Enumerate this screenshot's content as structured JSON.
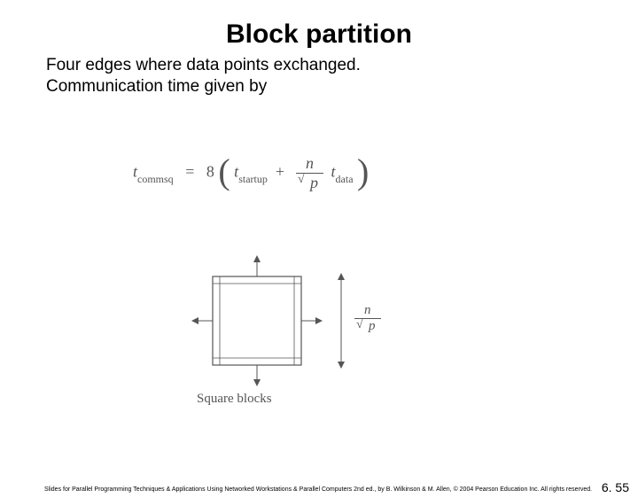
{
  "title": "Block partition",
  "body_line1": "Four edges where data points exchanged.",
  "body_line2": "Communication time given by",
  "equation": {
    "lhs_var": "t",
    "lhs_sub": "commsq",
    "eq": "=",
    "coef": "8",
    "term1_var": "t",
    "term1_sub": "startup",
    "plus": "+",
    "frac_num": "n",
    "frac_den_root": "p",
    "term2_var": "t",
    "term2_sub": "data"
  },
  "diagram": {
    "caption": "Square blocks",
    "side_frac_num": "n",
    "side_frac_den_root": "p"
  },
  "footer": "Slides for Parallel Programming Techniques & Applications Using Networked Workstations & Parallel Computers 2nd ed., by B. Wilkinson & M. Allen, © 2004 Pearson Education Inc. All rights reserved.",
  "page_number": "6. 55"
}
